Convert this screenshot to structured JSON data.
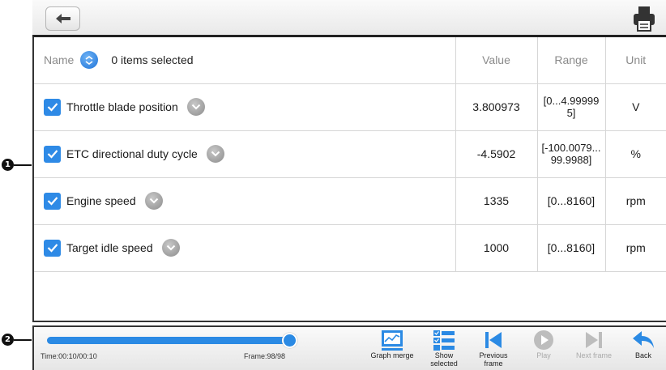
{
  "callouts": {
    "one": "1",
    "two": "2"
  },
  "header": {
    "name_label": "Name",
    "selected_count": "0 items selected",
    "value_label": "Value",
    "range_label": "Range",
    "unit_label": "Unit"
  },
  "rows": [
    {
      "name": "Throttle blade position",
      "value": "3.800973",
      "range": "[0...4.999995]",
      "unit": "V",
      "checked": true
    },
    {
      "name": "ETC directional duty cycle",
      "value": "-4.5902",
      "range": "[-100.0079...99.9988]",
      "unit": "%",
      "checked": true
    },
    {
      "name": "Engine speed",
      "value": "1335",
      "range": "[0...8160]",
      "unit": "rpm",
      "checked": true
    },
    {
      "name": "Target idle speed",
      "value": "1000",
      "range": "[0...8160]",
      "unit": "rpm",
      "checked": true
    }
  ],
  "playback": {
    "time": "Time:00:10/00:10",
    "frame": "Frame:98/98",
    "progress_fraction": 1.0
  },
  "toolbar": {
    "graph_merge": "Graph merge",
    "show_selected_1": "Show",
    "show_selected_2": "selected",
    "previous_frame_1": "Previous",
    "previous_frame_2": "frame",
    "play": "Play",
    "next_frame": "Next frame",
    "back": "Back"
  },
  "icons": {
    "top_back": "back-arrow-icon",
    "print": "printer-icon",
    "graph_merge": "graph-merge-icon",
    "show_selected": "list-check-icon",
    "previous_frame": "skip-previous-icon",
    "play": "play-icon",
    "next_frame": "skip-next-icon",
    "back": "return-arrow-icon"
  },
  "colors": {
    "accent": "#2b8ae4",
    "disabled": "#aaaaaa"
  }
}
